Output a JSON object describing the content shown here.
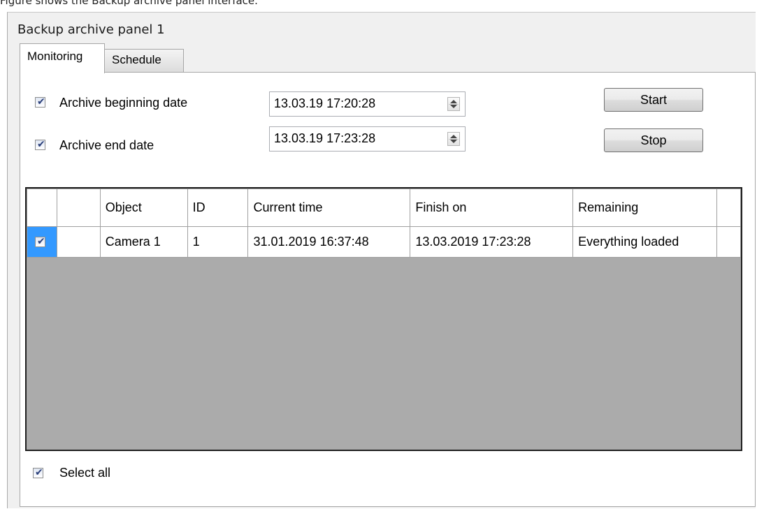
{
  "caption": "Figure shows the Backup archive panel interface.",
  "panel": {
    "title": "Backup archive panel 1"
  },
  "tabs": [
    {
      "label": "Monitoring",
      "active": true
    },
    {
      "label": "Schedule",
      "active": false
    }
  ],
  "filters": {
    "begin": {
      "label": "Archive beginning date",
      "checked": true,
      "value": "13.03.19 17:20:28"
    },
    "end": {
      "label": "Archive end date",
      "checked": true,
      "value": "13.03.19 17:23:28"
    }
  },
  "buttons": {
    "start": "Start",
    "stop": "Stop"
  },
  "grid": {
    "columns": [
      "",
      "",
      "Object",
      "ID",
      "Current time",
      "Finish on",
      "Remaining",
      ""
    ],
    "rows": [
      {
        "checked": true,
        "object": "Camera 1",
        "id": "1",
        "current_time": "31.01.2019 16:37:48",
        "finish_on": "13.03.2019 17:23:28",
        "remaining": "Everything loaded"
      }
    ]
  },
  "select_all": {
    "label": "Select all",
    "checked": true
  },
  "colors": {
    "selected_cell": "#3399ff",
    "grid_background": "#ababab",
    "panel_background": "#f0f0f0"
  }
}
